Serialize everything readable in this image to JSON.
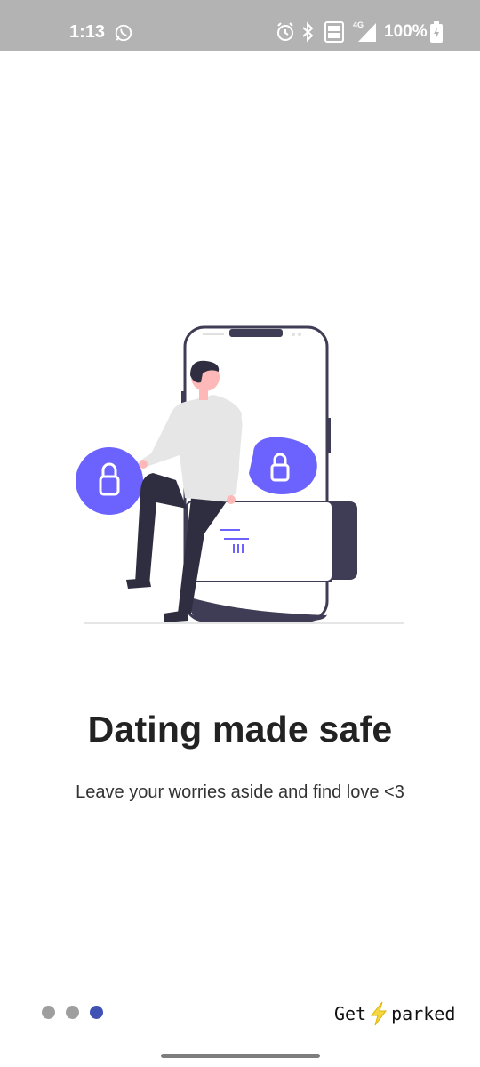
{
  "status_bar": {
    "time": "1:13",
    "battery": "100%",
    "network": "4G",
    "volte": "VoLTE"
  },
  "onboarding": {
    "title": "Dating made safe",
    "subtitle": "Leave your worries aside and find love <3",
    "pages_total": 3,
    "active_page": 3
  },
  "cta": {
    "part1": "Get",
    "part2": "parked"
  },
  "colors": {
    "accent": "#6c63ff",
    "dot_active": "#3f51b5",
    "dot_inactive": "#9e9e9e",
    "bolt": "#f5d742"
  }
}
